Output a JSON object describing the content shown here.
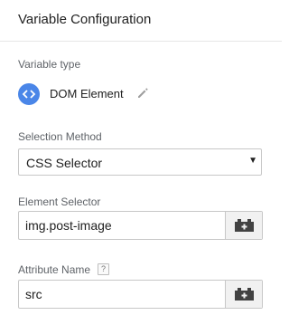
{
  "header": {
    "title": "Variable Configuration"
  },
  "variable_type": {
    "label": "Variable type",
    "value": "DOM Element",
    "icon": "dom-element-icon",
    "icon_color": "#4a86e8"
  },
  "selection_method": {
    "label": "Selection Method",
    "selected": "CSS Selector",
    "arrow": "▼"
  },
  "element_selector": {
    "label": "Element Selector",
    "value": "img.post-image",
    "button_icon": "variable-picker-icon"
  },
  "attribute_name": {
    "label": "Attribute Name",
    "help_glyph": "?",
    "value": "src",
    "button_icon": "variable-picker-icon"
  }
}
